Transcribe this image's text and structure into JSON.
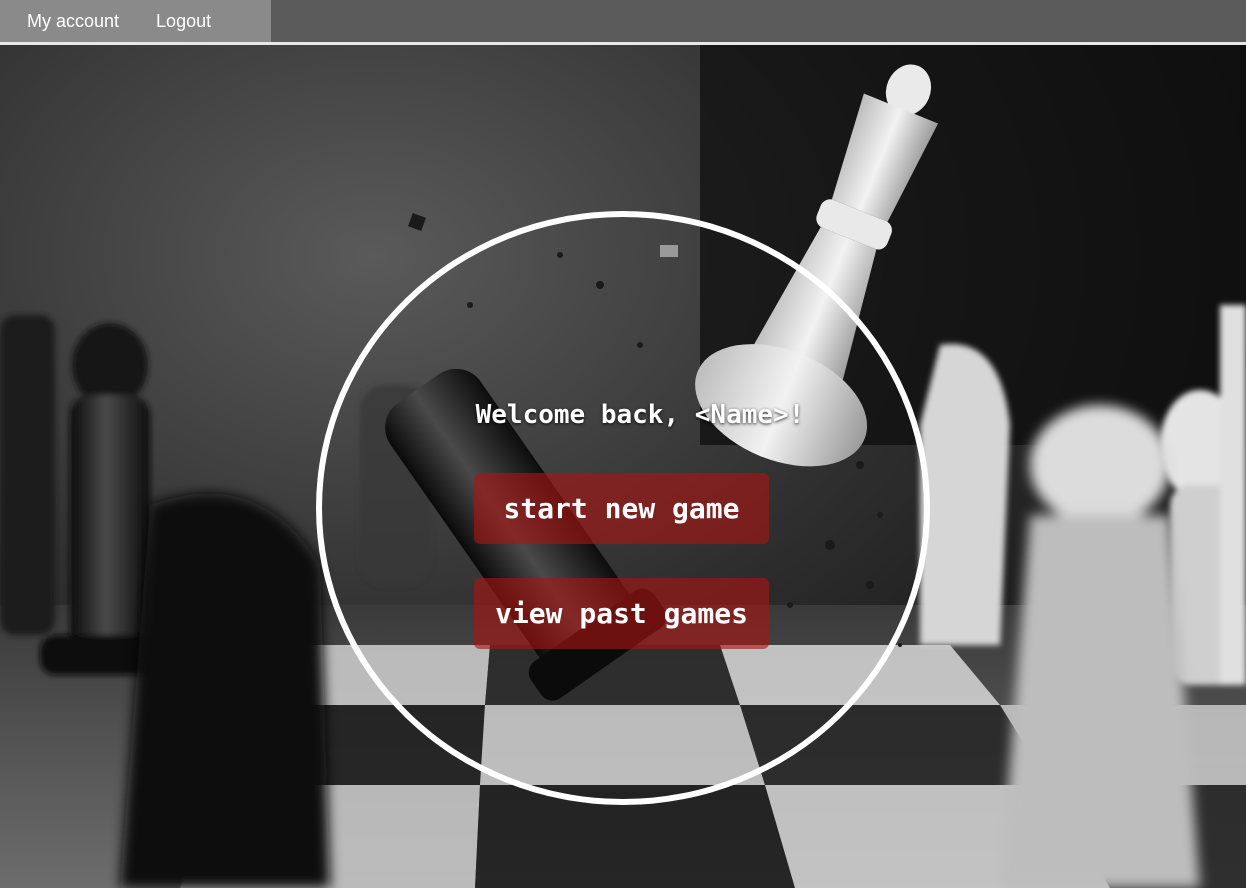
{
  "nav": {
    "my_account": "My account",
    "logout": "Logout"
  },
  "hero": {
    "background_image": "chess-scene",
    "welcome_text": "Welcome back, <Name>!",
    "buttons": {
      "start_new_game": "start new game",
      "view_past_games": "view past games"
    }
  },
  "colors": {
    "nav_bg": "#5b5b5b",
    "nav_active_bg": "#8a8a8a",
    "button_bg": "#aa1414",
    "ring": "#ffffff"
  }
}
